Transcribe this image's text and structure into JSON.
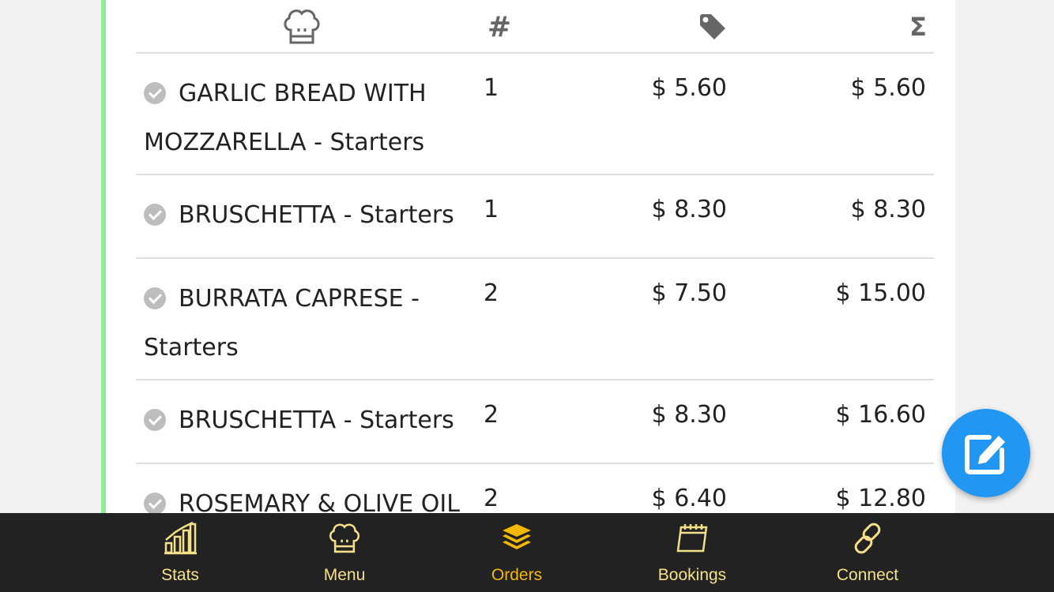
{
  "table": {
    "headers": {
      "item_icon": "chef-hat-icon",
      "qty": "#",
      "price_icon": "price-tag-icon",
      "total": "Σ"
    },
    "rows": [
      {
        "name": "GARLIC BREAD WITH MOZZARELLA - Starters",
        "qty": "1",
        "price": "$ 5.60",
        "total": "$ 5.60"
      },
      {
        "name": "BRUSCHETTA - Starters",
        "qty": "1",
        "price": "$ 8.30",
        "total": "$ 8.30"
      },
      {
        "name": "BURRATA CAPRESE - Starters",
        "qty": "2",
        "price": "$ 7.50",
        "total": "$ 15.00"
      },
      {
        "name": "BRUSCHETTA - Starters",
        "qty": "2",
        "price": "$ 8.30",
        "total": "$ 16.60"
      },
      {
        "name": "ROSEMARY & OLIVE OIL",
        "qty": "2",
        "price": "$ 6.40",
        "total": "$ 12.80"
      }
    ]
  },
  "fab": {
    "icon": "edit-icon"
  },
  "nav": {
    "items": [
      {
        "label": "Stats",
        "icon": "bar-chart-icon",
        "active": false
      },
      {
        "label": "Menu",
        "icon": "chef-hat-icon",
        "active": false
      },
      {
        "label": "Orders",
        "icon": "layers-icon",
        "active": true
      },
      {
        "label": "Bookings",
        "icon": "calendar-icon",
        "active": false
      },
      {
        "label": "Connect",
        "icon": "link-icon",
        "active": false
      }
    ]
  },
  "colors": {
    "accent_left_border": "#90ee90",
    "fab": "#2196f3",
    "nav_bg": "#222222",
    "nav_label": "#f5e08a",
    "nav_active": "#f5b800"
  }
}
